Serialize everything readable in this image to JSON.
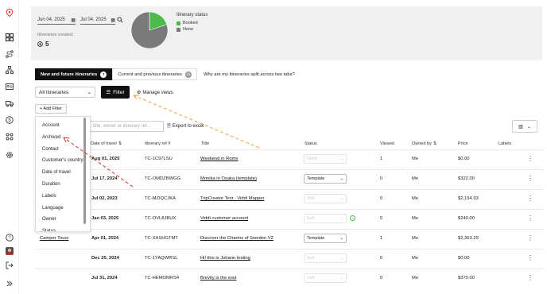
{
  "sidebar": {
    "icons": [
      "location-pin-icon",
      "dashboard-icon",
      "route-icon",
      "network-icon",
      "id-card-icon",
      "truck-icon",
      "dollar-icon",
      "apps-icon",
      "gear-icon",
      "help-icon",
      "avatar",
      "logout-icon",
      "expand-icon"
    ]
  },
  "summary": {
    "date_from": "Jun 04, 2025",
    "date_to": "Jul 04, 2025",
    "itineraries_created_label": "Itineraries created:",
    "itineraries_created_value": "5",
    "chart_data": {
      "type": "pie",
      "title": "Itinerary status",
      "categories": [
        "Booked",
        "None"
      ],
      "values": [
        20,
        80
      ],
      "colors": [
        "#4cbb4c",
        "#7a7a7a"
      ]
    }
  },
  "tabs": {
    "active_label": "New and future itineraries",
    "active_count": "7",
    "other_label": "Current and previous itineraries",
    "other_count": "21",
    "note": "Why are my itineraries split across two tabs?"
  },
  "toolbar": {
    "view_select": "All itineraries",
    "filter_label": "Filter",
    "manage_views": "Manage views",
    "add_filter": "+ Add Filter",
    "search_placeholder": "title, owner or itinerary ref...",
    "export_label": "Export to excel"
  },
  "table": {
    "headers": {
      "date": "Date of travel",
      "ref": "Itinerary ref #",
      "title": "Title",
      "status": "Status",
      "viewed": "Viewed",
      "owner": "Owned by",
      "price": "Price",
      "labels": "Labels"
    },
    "rows": [
      {
        "account": "",
        "date": "Aug 01, 2025",
        "ref": "TC-1C97LSU",
        "title": "Weekend in Rome",
        "status": "None",
        "status_disabled": true,
        "viewed": "1",
        "owner": "Me",
        "price": "$0.00"
      },
      {
        "account": "",
        "date": "Jul 17, 2024",
        "ref": "TC-OMDZBWGG",
        "title": "Monika in Osaka (template)",
        "status": "Template",
        "status_disabled": false,
        "viewed": "0",
        "owner": "Me",
        "price": "$322.00"
      },
      {
        "account": "",
        "date": "Jul 02, 2023",
        "ref": "TC-MZIQCJKA",
        "title": "TripCreator Test - Viddi Mapper",
        "status": "Sell",
        "status_disabled": true,
        "viewed": "0",
        "owner": "Me",
        "price": "$2,194.93"
      },
      {
        "account": "",
        "date": "Jan 03, 2025",
        "ref": "TC-OVL8JBUX",
        "title": "Viddi customer account",
        "status": "Sell",
        "status_disabled": true,
        "viewed": "0",
        "owner": "Me",
        "price": "$240.00"
      },
      {
        "account": "Camper Tours",
        "date": "Apr 01, 2024",
        "ref": "TC-XASHGTMT",
        "title": "Discover the Charms of Sweden V2",
        "status": "Template",
        "status_disabled": false,
        "viewed": "1",
        "owner": "Me",
        "price": "$2,363.29"
      },
      {
        "account": "",
        "date": "Dec 20, 2024",
        "ref": "TC-1YAQWRSL",
        "title": "Hi! this is Johann testing",
        "status": "Sell",
        "status_disabled": true,
        "viewed": "0",
        "owner": "Me",
        "price": "$0.00"
      },
      {
        "account": "",
        "date": "Jul 31, 2024",
        "ref": "TC-HEMOMRS4",
        "title": "Brevity is the soul",
        "status": "Sell",
        "status_disabled": true,
        "viewed": "0",
        "owner": "Me",
        "price": "$370.00"
      }
    ]
  },
  "filter_dropdown": {
    "items": [
      "Account",
      "Archived",
      "Contact",
      "Customer's country",
      "Date of travel",
      "Duration",
      "Labels",
      "Language",
      "Owner",
      "Status"
    ]
  },
  "colors": {
    "accent_dark": "#111111",
    "booked_green": "#4cbb4c",
    "none_grey": "#7a7a7a",
    "arrow_red": "#d9302c",
    "arrow_orange": "#f0a040",
    "logo_red": "#e0443c"
  }
}
